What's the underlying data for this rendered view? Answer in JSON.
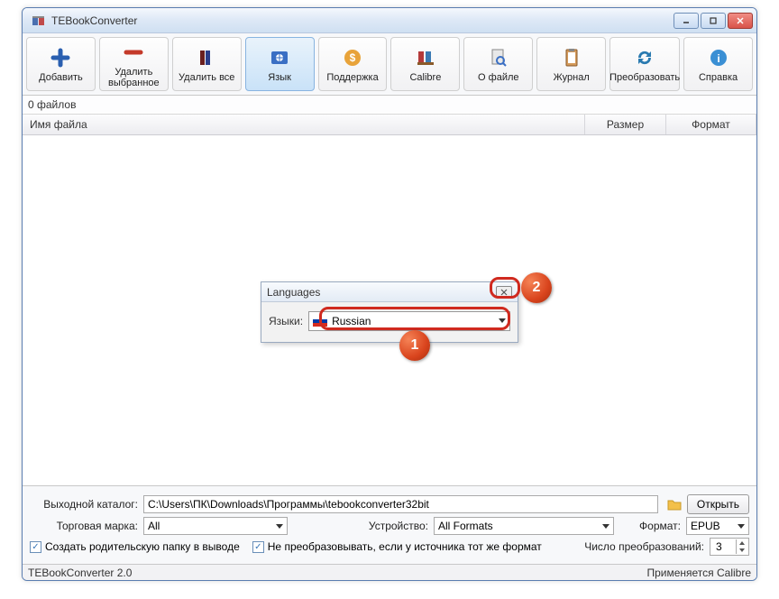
{
  "window": {
    "title": "TEBookConverter"
  },
  "toolbar": {
    "buttons": [
      {
        "label": "Добавить",
        "icon": "plus-icon"
      },
      {
        "label": "Удалить выбранное",
        "icon": "minus-icon"
      },
      {
        "label": "Удалить все",
        "icon": "books-icon"
      },
      {
        "label": "Язык",
        "icon": "globe-icon",
        "active": true
      },
      {
        "label": "Поддержка",
        "icon": "coin-icon"
      },
      {
        "label": "Calibre",
        "icon": "calibre-icon"
      },
      {
        "label": "О файле",
        "icon": "search-icon"
      },
      {
        "label": "Журнал",
        "icon": "clipboard-icon"
      },
      {
        "label": "Преобразовать",
        "icon": "refresh-icon"
      },
      {
        "label": "Справка",
        "icon": "info-icon"
      }
    ]
  },
  "countbar": {
    "text": "0 файлов"
  },
  "columns": {
    "name": "Имя файла",
    "size": "Размер",
    "format": "Формат"
  },
  "dialog": {
    "title": "Languages",
    "label": "Языки:",
    "value": "Russian"
  },
  "callouts": {
    "one": "1",
    "two": "2"
  },
  "bottom": {
    "out_label": "Выходной каталог:",
    "out_path": "C:\\Users\\ПК\\Downloads\\Программы\\tebookconverter32bit",
    "open": "Открыть",
    "brand_label": "Торговая марка:",
    "brand_value": "All",
    "device_label": "Устройство:",
    "device_value": "All Formats",
    "format_label": "Формат:",
    "format_value": "EPUB",
    "chk1": "Создать родительскую папку в выводе",
    "chk2": "Не преобразовывать, если у источника тот же формат",
    "conv_label": "Число преобразований:",
    "conv_value": "3"
  },
  "status": {
    "left": "TEBookConverter 2.0",
    "right": "Применяется Calibre"
  }
}
